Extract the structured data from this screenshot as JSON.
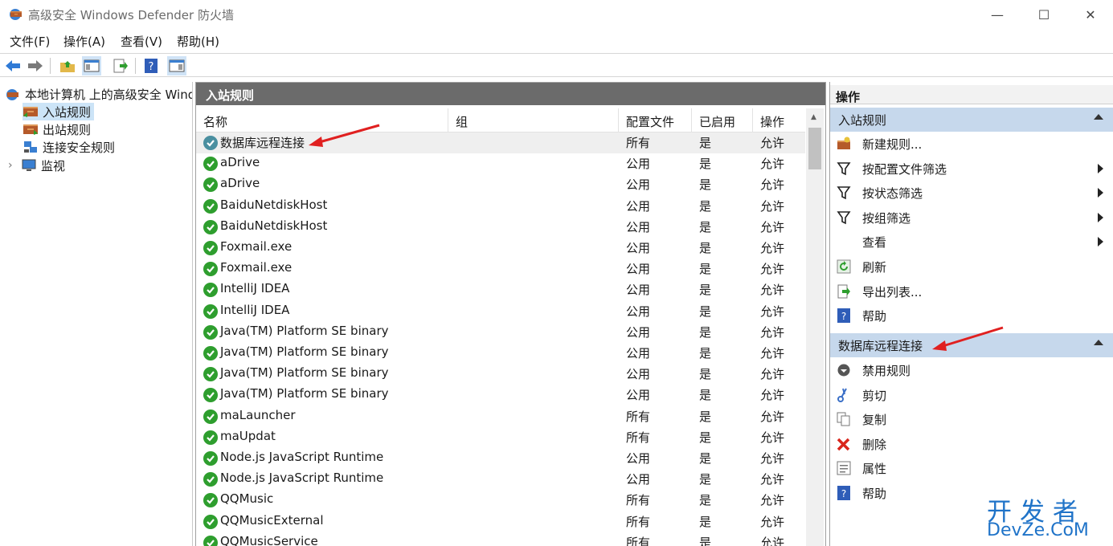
{
  "window": {
    "title": "高级安全 Windows Defender 防火墙",
    "minimize": "—",
    "maximize": "☐",
    "close": "✕"
  },
  "menu": [
    {
      "label": "文件(F)"
    },
    {
      "label": "操作(A)"
    },
    {
      "label": "查看(V)"
    },
    {
      "label": "帮助(H)"
    }
  ],
  "toolbar": {
    "icons": [
      "back-arrow-icon",
      "forward-arrow-icon",
      "up-folder-icon",
      "show-hide-tree-icon",
      "export-list-icon",
      "help-icon",
      "show-hide-action-pane-icon"
    ]
  },
  "tree": {
    "root": "本地计算机 上的高级安全 Windows Defender 防火墙",
    "items": [
      {
        "label": "入站规则",
        "selected": true
      },
      {
        "label": "出站规则"
      },
      {
        "label": "连接安全规则"
      },
      {
        "label": "监视",
        "expander": "›"
      }
    ]
  },
  "main": {
    "title": "入站规则",
    "columns": [
      "名称",
      "组",
      "配置文件",
      "已启用",
      "操作"
    ],
    "rows": [
      {
        "name": "数据库远程连接",
        "group": "",
        "profile": "所有",
        "enabled": "是",
        "action": "允许"
      },
      {
        "name": "aDrive",
        "group": "",
        "profile": "公用",
        "enabled": "是",
        "action": "允许"
      },
      {
        "name": "aDrive",
        "group": "",
        "profile": "公用",
        "enabled": "是",
        "action": "允许"
      },
      {
        "name": "BaiduNetdiskHost",
        "group": "",
        "profile": "公用",
        "enabled": "是",
        "action": "允许"
      },
      {
        "name": "BaiduNetdiskHost",
        "group": "",
        "profile": "公用",
        "enabled": "是",
        "action": "允许"
      },
      {
        "name": "Foxmail.exe",
        "group": "",
        "profile": "公用",
        "enabled": "是",
        "action": "允许"
      },
      {
        "name": "Foxmail.exe",
        "group": "",
        "profile": "公用",
        "enabled": "是",
        "action": "允许"
      },
      {
        "name": "IntelliJ IDEA",
        "group": "",
        "profile": "公用",
        "enabled": "是",
        "action": "允许"
      },
      {
        "name": "IntelliJ IDEA",
        "group": "",
        "profile": "公用",
        "enabled": "是",
        "action": "允许"
      },
      {
        "name": "Java(TM) Platform SE binary",
        "group": "",
        "profile": "公用",
        "enabled": "是",
        "action": "允许"
      },
      {
        "name": "Java(TM) Platform SE binary",
        "group": "",
        "profile": "公用",
        "enabled": "是",
        "action": "允许"
      },
      {
        "name": "Java(TM) Platform SE binary",
        "group": "",
        "profile": "公用",
        "enabled": "是",
        "action": "允许"
      },
      {
        "name": "Java(TM) Platform SE binary",
        "group": "",
        "profile": "公用",
        "enabled": "是",
        "action": "允许"
      },
      {
        "name": "maLauncher",
        "group": "",
        "profile": "所有",
        "enabled": "是",
        "action": "允许"
      },
      {
        "name": "maUpdat",
        "group": "",
        "profile": "所有",
        "enabled": "是",
        "action": "允许"
      },
      {
        "name": "Node.js JavaScript Runtime",
        "group": "",
        "profile": "公用",
        "enabled": "是",
        "action": "允许"
      },
      {
        "name": "Node.js JavaScript Runtime",
        "group": "",
        "profile": "公用",
        "enabled": "是",
        "action": "允许"
      },
      {
        "name": "QQMusic",
        "group": "",
        "profile": "所有",
        "enabled": "是",
        "action": "允许"
      },
      {
        "name": "QQMusicExternal",
        "group": "",
        "profile": "所有",
        "enabled": "是",
        "action": "允许"
      },
      {
        "name": "QQMusicService",
        "group": "",
        "profile": "所有",
        "enabled": "是",
        "action": "允许"
      }
    ]
  },
  "actions": {
    "header": "操作",
    "section1": {
      "title": "入站规则",
      "items": [
        {
          "label": "新建规则...",
          "icon": "new-rule-icon"
        },
        {
          "label": "按配置文件筛选",
          "icon": "filter-icon",
          "submenu": true
        },
        {
          "label": "按状态筛选",
          "icon": "filter-icon",
          "submenu": true
        },
        {
          "label": "按组筛选",
          "icon": "filter-icon",
          "submenu": true
        },
        {
          "label": "查看",
          "icon": "",
          "submenu": true
        },
        {
          "label": "刷新",
          "icon": "refresh-icon"
        },
        {
          "label": "导出列表...",
          "icon": "export-icon"
        },
        {
          "label": "帮助",
          "icon": "help-icon"
        }
      ]
    },
    "section2": {
      "title": "数据库远程连接",
      "items": [
        {
          "label": "禁用规则",
          "icon": "disable-icon"
        },
        {
          "label": "剪切",
          "icon": "cut-icon"
        },
        {
          "label": "复制",
          "icon": "copy-icon"
        },
        {
          "label": "删除",
          "icon": "delete-icon"
        },
        {
          "label": "属性",
          "icon": "properties-icon"
        },
        {
          "label": "帮助",
          "icon": "help-icon"
        }
      ]
    }
  },
  "watermark": {
    "line1": "开发者",
    "line2": "DevZe.CoM"
  },
  "colors": {
    "accent": "#1f73c8",
    "annotation": "#e02020",
    "allow_green": "#2e9e2e",
    "section_bg": "#c6d8ec"
  }
}
